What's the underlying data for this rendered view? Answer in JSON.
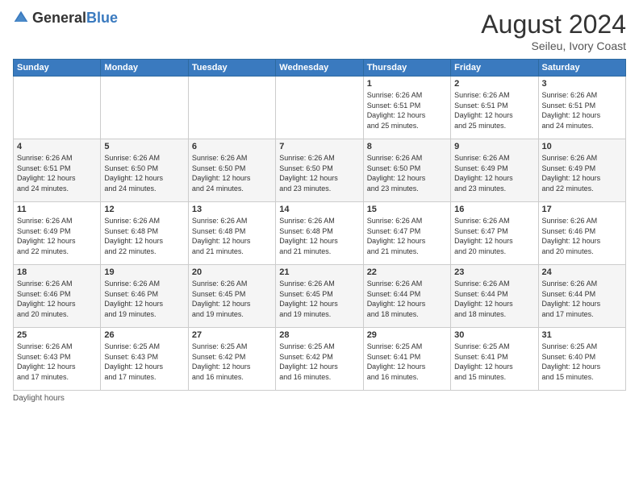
{
  "header": {
    "logo_general": "General",
    "logo_blue": "Blue",
    "month_year": "August 2024",
    "location": "Seileu, Ivory Coast"
  },
  "days_of_week": [
    "Sunday",
    "Monday",
    "Tuesday",
    "Wednesday",
    "Thursday",
    "Friday",
    "Saturday"
  ],
  "weeks": [
    [
      {
        "day": "",
        "info": ""
      },
      {
        "day": "",
        "info": ""
      },
      {
        "day": "",
        "info": ""
      },
      {
        "day": "",
        "info": ""
      },
      {
        "day": "1",
        "info": "Sunrise: 6:26 AM\nSunset: 6:51 PM\nDaylight: 12 hours\nand 25 minutes."
      },
      {
        "day": "2",
        "info": "Sunrise: 6:26 AM\nSunset: 6:51 PM\nDaylight: 12 hours\nand 25 minutes."
      },
      {
        "day": "3",
        "info": "Sunrise: 6:26 AM\nSunset: 6:51 PM\nDaylight: 12 hours\nand 24 minutes."
      }
    ],
    [
      {
        "day": "4",
        "info": "Sunrise: 6:26 AM\nSunset: 6:51 PM\nDaylight: 12 hours\nand 24 minutes."
      },
      {
        "day": "5",
        "info": "Sunrise: 6:26 AM\nSunset: 6:50 PM\nDaylight: 12 hours\nand 24 minutes."
      },
      {
        "day": "6",
        "info": "Sunrise: 6:26 AM\nSunset: 6:50 PM\nDaylight: 12 hours\nand 24 minutes."
      },
      {
        "day": "7",
        "info": "Sunrise: 6:26 AM\nSunset: 6:50 PM\nDaylight: 12 hours\nand 23 minutes."
      },
      {
        "day": "8",
        "info": "Sunrise: 6:26 AM\nSunset: 6:50 PM\nDaylight: 12 hours\nand 23 minutes."
      },
      {
        "day": "9",
        "info": "Sunrise: 6:26 AM\nSunset: 6:49 PM\nDaylight: 12 hours\nand 23 minutes."
      },
      {
        "day": "10",
        "info": "Sunrise: 6:26 AM\nSunset: 6:49 PM\nDaylight: 12 hours\nand 22 minutes."
      }
    ],
    [
      {
        "day": "11",
        "info": "Sunrise: 6:26 AM\nSunset: 6:49 PM\nDaylight: 12 hours\nand 22 minutes."
      },
      {
        "day": "12",
        "info": "Sunrise: 6:26 AM\nSunset: 6:48 PM\nDaylight: 12 hours\nand 22 minutes."
      },
      {
        "day": "13",
        "info": "Sunrise: 6:26 AM\nSunset: 6:48 PM\nDaylight: 12 hours\nand 21 minutes."
      },
      {
        "day": "14",
        "info": "Sunrise: 6:26 AM\nSunset: 6:48 PM\nDaylight: 12 hours\nand 21 minutes."
      },
      {
        "day": "15",
        "info": "Sunrise: 6:26 AM\nSunset: 6:47 PM\nDaylight: 12 hours\nand 21 minutes."
      },
      {
        "day": "16",
        "info": "Sunrise: 6:26 AM\nSunset: 6:47 PM\nDaylight: 12 hours\nand 20 minutes."
      },
      {
        "day": "17",
        "info": "Sunrise: 6:26 AM\nSunset: 6:46 PM\nDaylight: 12 hours\nand 20 minutes."
      }
    ],
    [
      {
        "day": "18",
        "info": "Sunrise: 6:26 AM\nSunset: 6:46 PM\nDaylight: 12 hours\nand 20 minutes."
      },
      {
        "day": "19",
        "info": "Sunrise: 6:26 AM\nSunset: 6:46 PM\nDaylight: 12 hours\nand 19 minutes."
      },
      {
        "day": "20",
        "info": "Sunrise: 6:26 AM\nSunset: 6:45 PM\nDaylight: 12 hours\nand 19 minutes."
      },
      {
        "day": "21",
        "info": "Sunrise: 6:26 AM\nSunset: 6:45 PM\nDaylight: 12 hours\nand 19 minutes."
      },
      {
        "day": "22",
        "info": "Sunrise: 6:26 AM\nSunset: 6:44 PM\nDaylight: 12 hours\nand 18 minutes."
      },
      {
        "day": "23",
        "info": "Sunrise: 6:26 AM\nSunset: 6:44 PM\nDaylight: 12 hours\nand 18 minutes."
      },
      {
        "day": "24",
        "info": "Sunrise: 6:26 AM\nSunset: 6:44 PM\nDaylight: 12 hours\nand 17 minutes."
      }
    ],
    [
      {
        "day": "25",
        "info": "Sunrise: 6:26 AM\nSunset: 6:43 PM\nDaylight: 12 hours\nand 17 minutes."
      },
      {
        "day": "26",
        "info": "Sunrise: 6:25 AM\nSunset: 6:43 PM\nDaylight: 12 hours\nand 17 minutes."
      },
      {
        "day": "27",
        "info": "Sunrise: 6:25 AM\nSunset: 6:42 PM\nDaylight: 12 hours\nand 16 minutes."
      },
      {
        "day": "28",
        "info": "Sunrise: 6:25 AM\nSunset: 6:42 PM\nDaylight: 12 hours\nand 16 minutes."
      },
      {
        "day": "29",
        "info": "Sunrise: 6:25 AM\nSunset: 6:41 PM\nDaylight: 12 hours\nand 16 minutes."
      },
      {
        "day": "30",
        "info": "Sunrise: 6:25 AM\nSunset: 6:41 PM\nDaylight: 12 hours\nand 15 minutes."
      },
      {
        "day": "31",
        "info": "Sunrise: 6:25 AM\nSunset: 6:40 PM\nDaylight: 12 hours\nand 15 minutes."
      }
    ]
  ],
  "footer": {
    "daylight_label": "Daylight hours"
  }
}
